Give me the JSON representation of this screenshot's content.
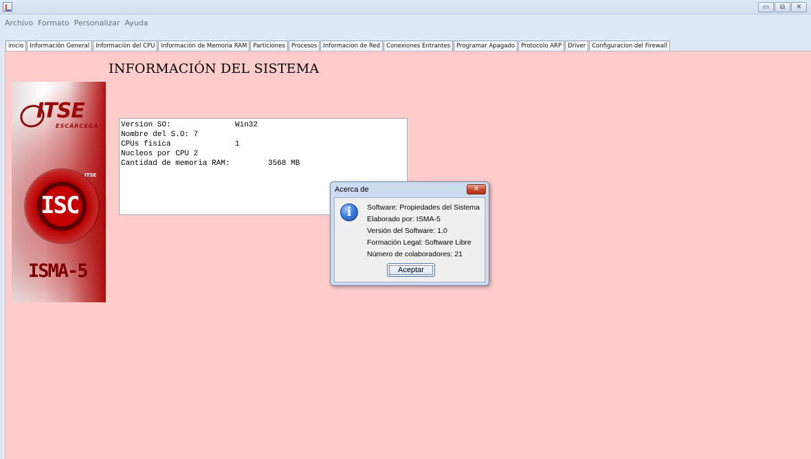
{
  "menubar": {
    "items": [
      "Archivo",
      "Formato",
      "Personalizar",
      "Ayuda"
    ]
  },
  "window_controls": {
    "minimize": "▭",
    "restore": "⧉",
    "close": "✕"
  },
  "tabs": [
    {
      "label": "inicio",
      "active": true
    },
    {
      "label": "Información General"
    },
    {
      "label": "Información del CPU"
    },
    {
      "label": "Información de Memoria RAM"
    },
    {
      "label": "Particiones"
    },
    {
      "label": "Procesos"
    },
    {
      "label": "Informacion de Red"
    },
    {
      "label": "Conexiones Entrantes"
    },
    {
      "label": "Programar Apagado"
    },
    {
      "label": "Protocolo ARP"
    },
    {
      "label": "Driver"
    },
    {
      "label": "Configuracion del Firewall"
    }
  ],
  "main": {
    "title": "INFORMACIÓN DEL SISTEMA"
  },
  "logo": {
    "itse": "ITSE",
    "itse_sub": "ESCÁRCEGA",
    "isc": "ISC",
    "itse_badge": "ITSE",
    "isma": "ISMA-5"
  },
  "system_info": {
    "lines": [
      {
        "label": "Version SO:",
        "value": "Win32"
      },
      {
        "label": "Nombre del S.O: 7",
        "value": ""
      },
      {
        "label": "CPUs fisica",
        "value": "1"
      },
      {
        "label": "Nucleos por CPU 2",
        "value": ""
      },
      {
        "label": "Cantidad de memoria RAM:",
        "value": "3568 MB"
      }
    ]
  },
  "dialog": {
    "title": "Acerca de",
    "close_glyph": "✕",
    "icon_glyph": "i",
    "lines": [
      "Software: Propiedades del Sistema",
      "Elaborado por: ISMA-5",
      "Versión del Software: 1.0",
      "Formación Legal: Software Libre",
      "Número de colaboradores: 21"
    ],
    "accept_label": "Aceptar"
  }
}
